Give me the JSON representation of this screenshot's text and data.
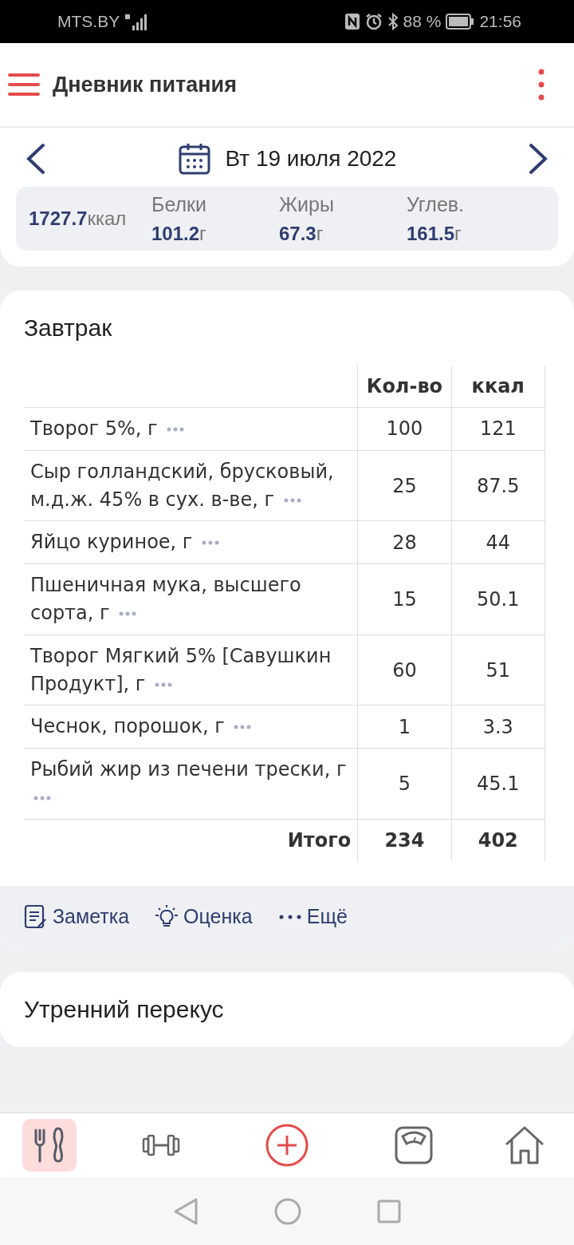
{
  "status_bar": {
    "carrier": "MTS.BY",
    "battery": "88 %",
    "time": "21:56"
  },
  "app_bar": {
    "title": "Дневник питания"
  },
  "date_nav": {
    "date": "Вт 19 июля 2022"
  },
  "summary": {
    "calories": "1727.7",
    "calories_unit": "ккал",
    "macros": [
      {
        "label": "Белки",
        "value": "101.2",
        "unit": "г"
      },
      {
        "label": "Жиры",
        "value": "67.3",
        "unit": "г"
      },
      {
        "label": "Углев.",
        "value": "161.5",
        "unit": "г"
      }
    ]
  },
  "meals": [
    {
      "title": "Завтрак",
      "columns": [
        "Кол-во",
        "ккал"
      ],
      "rows": [
        {
          "name": "Творог 5%, г",
          "qty": "100",
          "kcal": "121"
        },
        {
          "name": "Сыр голландский, брусковый, м.д.ж. 45% в сух. в-ве, г",
          "qty": "25",
          "kcal": "87.5"
        },
        {
          "name": "Яйцо куриное, г",
          "qty": "28",
          "kcal": "44"
        },
        {
          "name": "Пшеничная мука, высшего сорта, г",
          "qty": "15",
          "kcal": "50.1"
        },
        {
          "name": "Творог Мягкий 5% [Савушкин Продукт], г",
          "qty": "60",
          "kcal": "51"
        },
        {
          "name": "Чеснок, порошок, г",
          "qty": "1",
          "kcal": "3.3"
        },
        {
          "name": "Рыбий жир из печени трески, г",
          "qty": "5",
          "kcal": "45.1"
        }
      ],
      "total": {
        "label": "Итого",
        "qty": "234",
        "kcal": "402"
      },
      "actions": [
        {
          "kind": "note",
          "label": "Заметка"
        },
        {
          "kind": "rating",
          "label": "Оценка"
        },
        {
          "kind": "more",
          "label": "Ещё"
        }
      ]
    },
    {
      "title": "Утренний перекус"
    }
  ],
  "bottom_nav": [
    {
      "kind": "food",
      "selected": true
    },
    {
      "kind": "workout",
      "selected": false
    },
    {
      "kind": "add",
      "selected": false
    },
    {
      "kind": "scale",
      "selected": false
    },
    {
      "kind": "home",
      "selected": false
    }
  ]
}
